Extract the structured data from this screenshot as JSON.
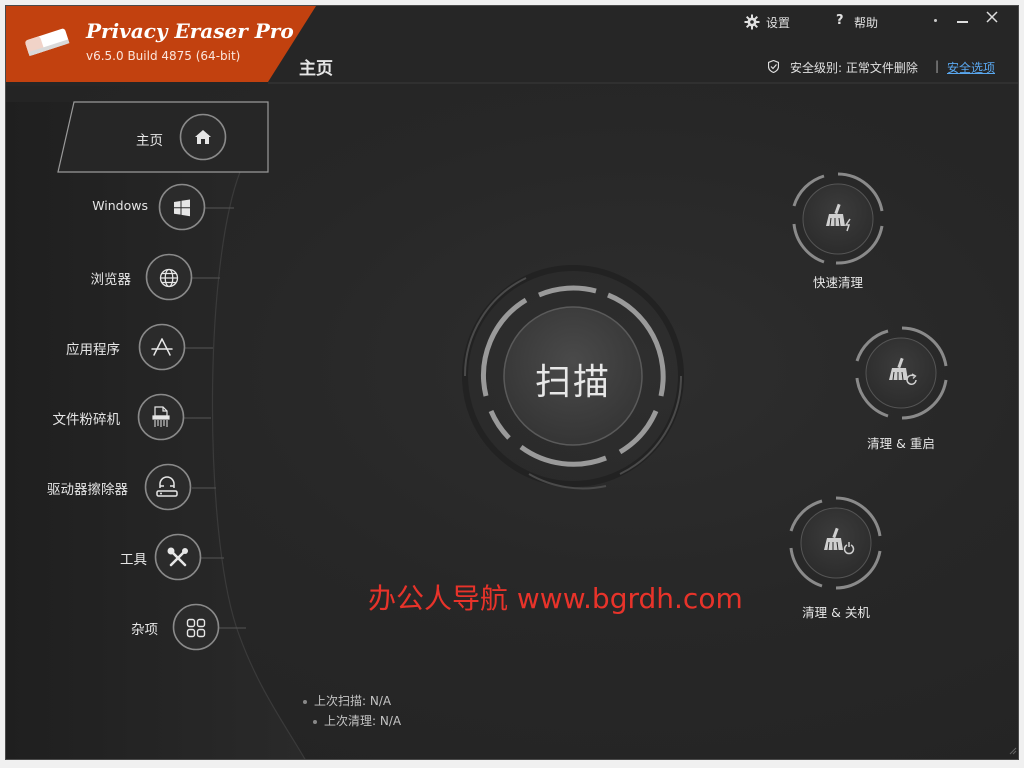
{
  "app": {
    "title": "Privacy Eraser Pro",
    "version": "v6.5.0 Build 4875 (64-bit)",
    "brand_color": "#c2410f"
  },
  "titlebar": {
    "settings_label": "设置",
    "help_label": "帮助"
  },
  "header": {
    "page_title": "主页",
    "security_level": "安全级别: 正常文件删除",
    "separator": "|",
    "security_options_link": "安全选项"
  },
  "sidebar": {
    "items": [
      {
        "label": "主页",
        "icon": "home-icon"
      },
      {
        "label": "Windows",
        "icon": "windows-icon"
      },
      {
        "label": "浏览器",
        "icon": "globe-icon"
      },
      {
        "label": "应用程序",
        "icon": "app-store-icon"
      },
      {
        "label": "文件粉碎机",
        "icon": "shredder-icon"
      },
      {
        "label": "驱动器擦除器",
        "icon": "drive-wiper-icon"
      },
      {
        "label": "工具",
        "icon": "tools-icon"
      },
      {
        "label": "杂项",
        "icon": "grid-icon"
      }
    ]
  },
  "scan": {
    "label": "扫描"
  },
  "quick_actions": [
    {
      "label": "快速清理",
      "icon": "broom-bolt-icon"
    },
    {
      "label": "清理 & 重启",
      "icon": "broom-restart-icon"
    },
    {
      "label": "清理 & 关机",
      "icon": "broom-power-icon"
    }
  ],
  "status": {
    "last_scan": "上次扫描: N/A",
    "last_clean": "上次清理: N/A"
  },
  "watermark": "办公人导航 www.bgrdh.com"
}
